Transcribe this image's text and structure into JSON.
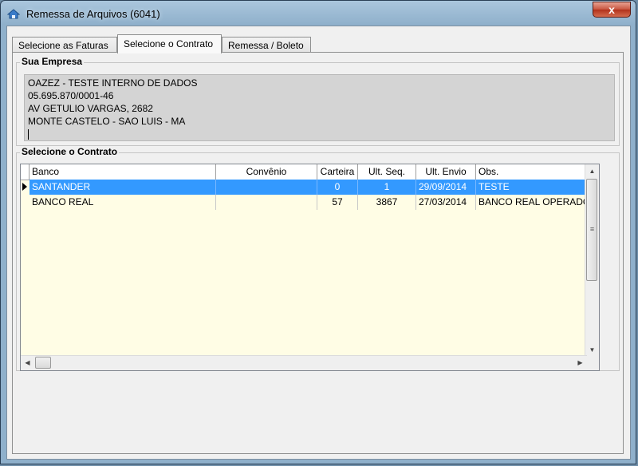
{
  "window": {
    "title": "Remessa de Arquivos (6041)",
    "close_label": "x"
  },
  "tabs": [
    {
      "label": "Selecione as Faturas"
    },
    {
      "label": "Selecione o Contrato",
      "active": true
    },
    {
      "label": "Remessa / Boleto"
    }
  ],
  "company": {
    "group_title": "Sua Empresa",
    "lines": [
      "OAZEZ - TESTE INTERNO DE DADOS",
      "05.695.870/0001-46",
      "AV GETULIO VARGAS, 2682",
      "MONTE CASTELO - SAO LUIS - MA"
    ]
  },
  "contracts": {
    "group_title": "Selecione o Contrato",
    "columns": [
      "Banco",
      "Convênio",
      "Carteira",
      "Ult. Seq.",
      "Ult. Envio",
      "Obs."
    ],
    "rows": [
      {
        "banco": "SANTANDER",
        "convenio": "",
        "carteira": "0",
        "ult_seq": "1",
        "ult_envio": "29/09/2014",
        "obs": "TESTE",
        "selected": true
      },
      {
        "banco": "BANCO REAL",
        "convenio": "",
        "carteira": "57",
        "ult_seq": "3867",
        "ult_envio": "27/03/2014",
        "obs": "BANCO REAL OPERADORA",
        "selected": false
      }
    ]
  },
  "scroll": {
    "up_arrow": "▲",
    "down_arrow": "▼",
    "left_arrow": "◀",
    "right_arrow": "▶",
    "grip": "≡"
  }
}
